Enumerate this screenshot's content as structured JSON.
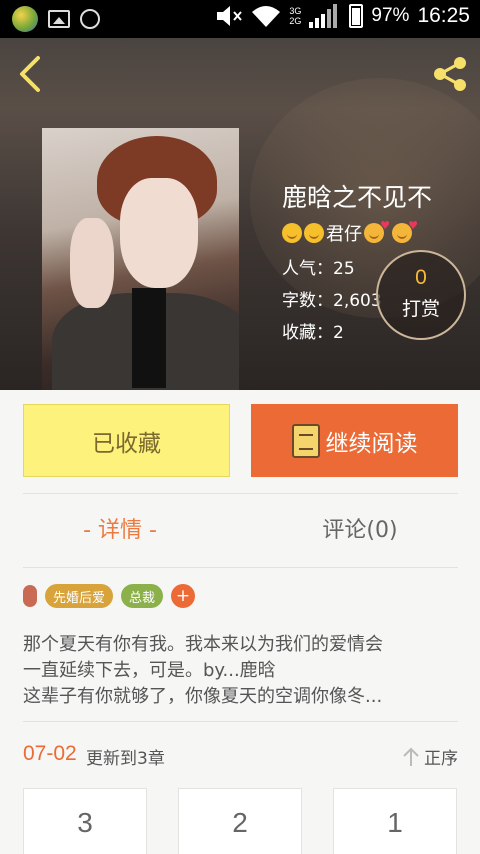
{
  "status_bar": {
    "network_3g": "3G",
    "network_2g": "2G",
    "battery": "97%",
    "time": "16:25"
  },
  "book": {
    "title": "鹿晗之不见不",
    "author": "君仔",
    "stats": {
      "popularity": "人气：25",
      "word_count": "字数：2,603",
      "favorites": "收藏：2"
    },
    "reward": {
      "count": "0",
      "label": "打赏"
    }
  },
  "actions": {
    "favorited": "已收藏",
    "continue_reading": "继续阅读"
  },
  "tabs": {
    "details": "- 详情 -",
    "comments": "评论(0)"
  },
  "tags": [
    "先婚后爱",
    "总裁"
  ],
  "tag_add": "+",
  "description": [
    "那个夏天有你有我。我本来以为我们的爱情会",
    "一直延续下去，可是。by...鹿晗",
    "这辈子有你就够了，你像夏天的空调你像冬..."
  ],
  "updates": {
    "date": "07-02",
    "text": "更新到3章",
    "sort_label": "正序"
  },
  "chapters": [
    "3",
    "2",
    "1"
  ],
  "colors": {
    "accent": "#ec6a35",
    "favorite_bg": "#fdf27c",
    "tab_active": "#ec7a40"
  }
}
